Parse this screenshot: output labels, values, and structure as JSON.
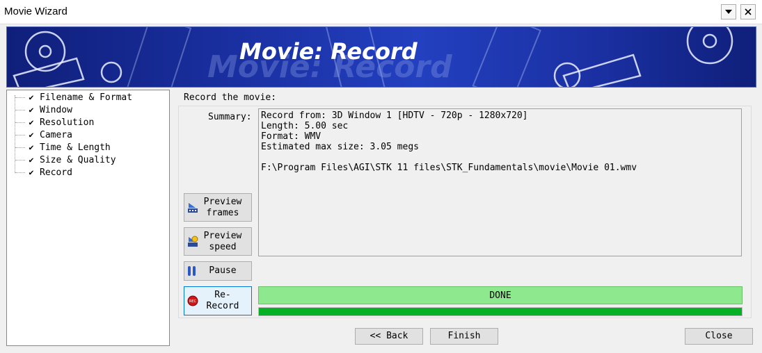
{
  "window": {
    "title": "Movie Wizard"
  },
  "banner": {
    "title": "Movie: Record"
  },
  "steps": [
    {
      "label": "Filename & Format"
    },
    {
      "label": "Window"
    },
    {
      "label": "Resolution"
    },
    {
      "label": "Camera"
    },
    {
      "label": "Time & Length"
    },
    {
      "label": "Size & Quality"
    },
    {
      "label": "Record"
    }
  ],
  "record": {
    "group_label": "Record the movie:",
    "summary_label": "Summary:",
    "summary_text": "Record from: 3D Window 1 [HDTV - 720p - 1280x720]\nLength: 5.00 sec\nFormat: WMV\nEstimated max size: 3.05 megs\n\nF:\\Program Files\\AGI\\STK 11 files\\STK_Fundamentals\\movie\\Movie 01.wmv",
    "preview_frames": "Preview\nframes",
    "preview_speed": "Preview\nspeed",
    "pause": "Pause",
    "rerecord": "Re-\nRecord",
    "status": "DONE",
    "progress": 1.0
  },
  "footer": {
    "back": "<< Back",
    "finish": "Finish",
    "close": "Close"
  },
  "colors": {
    "status_bg": "#8ee88e",
    "progress_fill": "#06b025",
    "banner": "#1a2fa0"
  }
}
